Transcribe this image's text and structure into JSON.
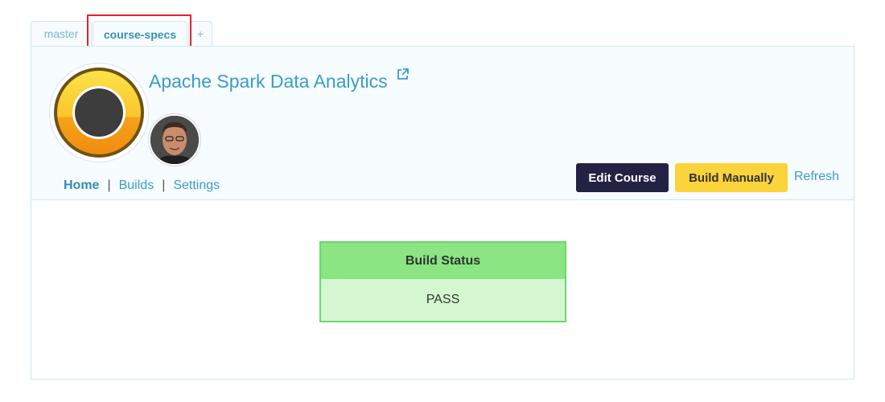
{
  "tabs": [
    {
      "label": "master"
    },
    {
      "label": "course-specs"
    },
    {
      "label": "+"
    }
  ],
  "course": {
    "title": "Apache Spark Data Analytics"
  },
  "nav": {
    "items": [
      {
        "label": "Home"
      },
      {
        "label": "Builds"
      },
      {
        "label": "Settings"
      }
    ],
    "separator": "|"
  },
  "actions": {
    "edit_label": "Edit Course",
    "build_label": "Build Manually",
    "refresh_label": "Refresh"
  },
  "build_status": {
    "header": "Build Status",
    "value": "PASS"
  },
  "colors": {
    "accent": "#3a9cc8",
    "edit_button": "#222244",
    "build_button": "#fbd33a",
    "status_header": "#8ae582",
    "status_body": "#d4f6d0",
    "highlight": "#e0252c"
  }
}
